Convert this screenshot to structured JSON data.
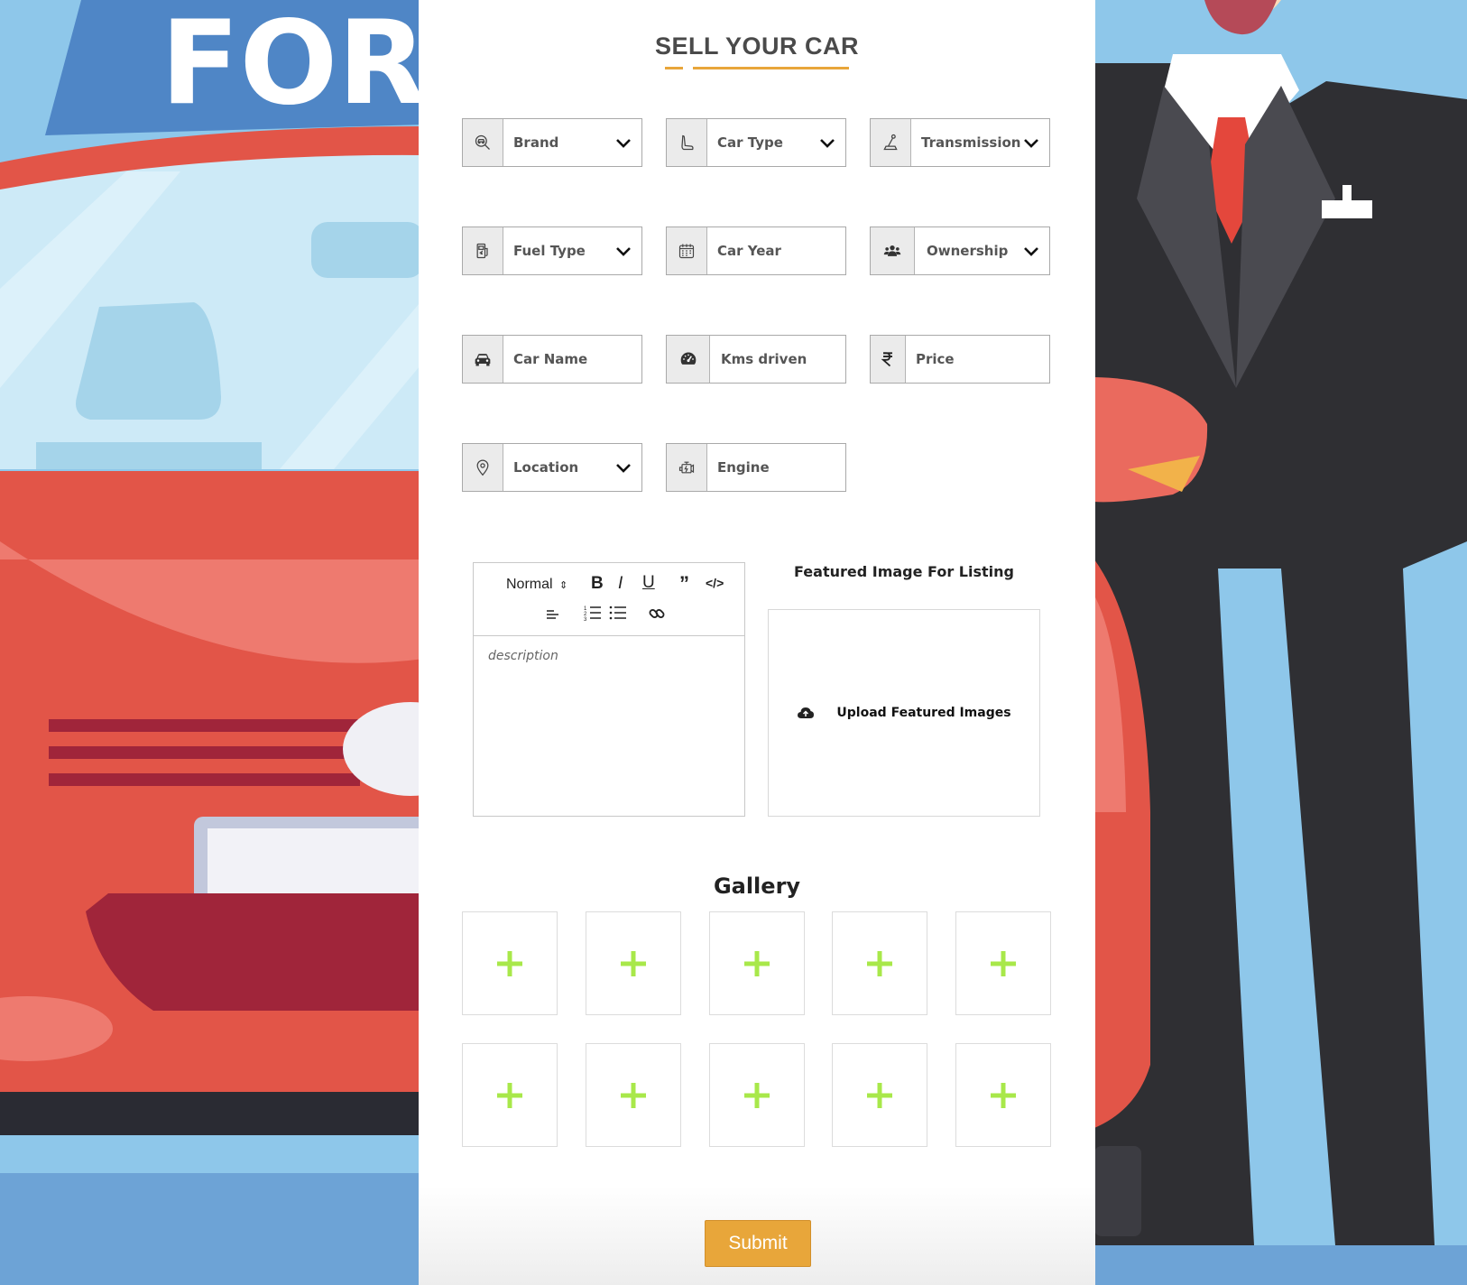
{
  "background": {
    "sign_text": "FOR S"
  },
  "form": {
    "title": "SELL YOUR CAR",
    "fields": {
      "brand": {
        "label": "Brand",
        "icon": "car-search-icon"
      },
      "car_type": {
        "label": "Car Type",
        "icon": "car-seat-icon"
      },
      "transmission": {
        "label": "Transmission",
        "icon": "gear-stick-icon"
      },
      "fuel_type": {
        "label": "Fuel Type",
        "icon": "fuel-pump-icon"
      },
      "car_year": {
        "label": "Car Year",
        "icon": "calendar-icon"
      },
      "ownership": {
        "label": "Ownership",
        "icon": "users-icon"
      },
      "car_name": {
        "label": "Car Name",
        "icon": "car-icon"
      },
      "kms_driven": {
        "label": "Kms driven",
        "icon": "speedometer-icon"
      },
      "price": {
        "label": "Price",
        "icon": "rupee-icon"
      },
      "location": {
        "label": "Location",
        "icon": "map-pin-icon"
      },
      "engine": {
        "label": "Engine",
        "icon": "engine-icon"
      }
    },
    "editor": {
      "format_select": "Normal",
      "placeholder": "description"
    },
    "featured": {
      "title": "Featured Image For Listing",
      "upload_label": "Upload Featured Images"
    },
    "gallery": {
      "title": "Gallery"
    },
    "submit_label": "Submit"
  },
  "colors": {
    "accent": "#e8a63a",
    "plus": "#a8e84a",
    "car_red": "#e25548",
    "sky": "#8ec7ea"
  }
}
